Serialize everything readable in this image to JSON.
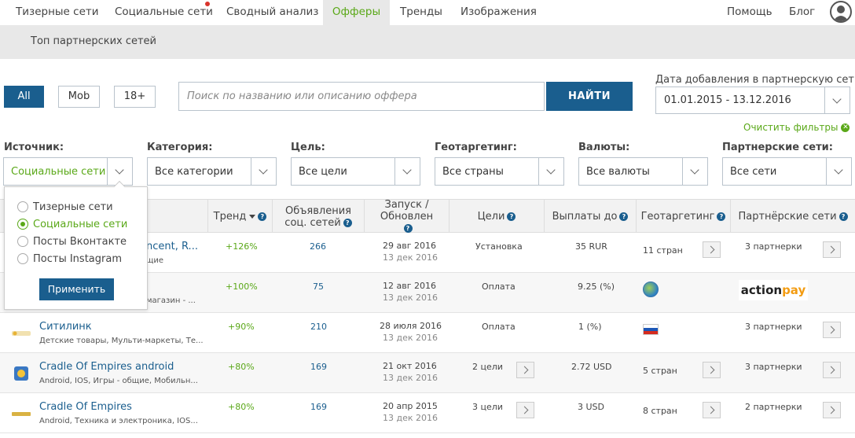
{
  "nav": {
    "items": [
      {
        "label": "Тизерные сети"
      },
      {
        "label": "Социальные сети"
      },
      {
        "label": "Сводный анализ"
      },
      {
        "label": "Офферы"
      },
      {
        "label": "Тренды"
      },
      {
        "label": "Изображения"
      }
    ],
    "active": "Офферы",
    "help": "Помощь",
    "blog": "Блог"
  },
  "subnav": {
    "label": "Топ партнерских сетей"
  },
  "toolbar": {
    "all": "All",
    "mob": "Mob",
    "adult": "18+"
  },
  "search": {
    "placeholder": "Поиск по названию или описанию оффера",
    "button": "НАЙТИ"
  },
  "date": {
    "label": "Дата добавления в партнерскую сеть",
    "value": "01.01.2015 - 13.12.2016"
  },
  "clear_filters": "Очистить фильтры",
  "filters": [
    {
      "label": "Источник:",
      "value": "Социальные сети"
    },
    {
      "label": "Категория:",
      "value": "Все категории"
    },
    {
      "label": "Цель:",
      "value": "Все цели"
    },
    {
      "label": "Геотаргетинг:",
      "value": "Все страны"
    },
    {
      "label": "Валюты:",
      "value": "Все валюты"
    },
    {
      "label": "Партнерские сети:",
      "value": "Все сети"
    }
  ],
  "source_popup": {
    "options": [
      "Тизерные сети",
      "Социальные сети",
      "Посты Вконтакте",
      "Посты Instagram"
    ],
    "selected": "Социальные сети",
    "apply": "Применить"
  },
  "table": {
    "headers": {
      "trend": "Тренд",
      "ads": "Объявления соц. сетей",
      "launch": "Запуск / Обновлен",
      "goals": "Цели",
      "payout": "Выплаты до",
      "geo": "Геотаргетинг",
      "networks": "Партнёрские сети"
    },
    "rows": [
      {
        "name": "ncent, R...",
        "category": "щие",
        "trend": "+126%",
        "ads": "266",
        "launch": "29 авг 2016",
        "updated": "13 дек 2016",
        "goals": "Установка",
        "payout": "35 RUR",
        "geo": "11 стран",
        "networks": "3 партнерки"
      },
      {
        "name": "",
        "category": "магазин - ...",
        "trend": "+100%",
        "ads": "75",
        "launch": "12 авг 2016",
        "updated": "13 дек 2016",
        "goals": "Оплата",
        "payout": "9.25 (%)",
        "geo": "",
        "networks": ""
      },
      {
        "name": "Ситилинк",
        "category": "Детские товары, Мульти-маркеты, Те...",
        "trend": "+90%",
        "ads": "210",
        "launch": "28 июля 2016",
        "updated": "13 дек 2016",
        "goals": "Оплата",
        "payout": "1 (%)",
        "geo": "",
        "networks": "3 партнерки"
      },
      {
        "name": "Cradle Of Empires android",
        "category": "Android, IOS, Игры - общие, Мобильн...",
        "trend": "+80%",
        "ads": "169",
        "launch": "21 окт 2016",
        "updated": "13 дек 2016",
        "goals": "2 цели",
        "payout": "2.72 USD",
        "geo": "5 стран",
        "networks": "3 партнерки"
      },
      {
        "name": "Cradle Of Empires",
        "category": "Android, Техника и электроника, IOS...",
        "trend": "+80%",
        "ads": "169",
        "launch": "20 апр 2015",
        "updated": "13 дек 2016",
        "goals": "3 цели",
        "payout": "3 USD",
        "geo": "8 стран",
        "networks": "2 партнерки"
      }
    ],
    "row2_network_logo": {
      "part1": "action",
      "part2": "pay"
    }
  },
  "colors": {
    "accent": "#1a5e8e",
    "green": "#5aa818",
    "nav_bg": "#e8e8e8"
  }
}
